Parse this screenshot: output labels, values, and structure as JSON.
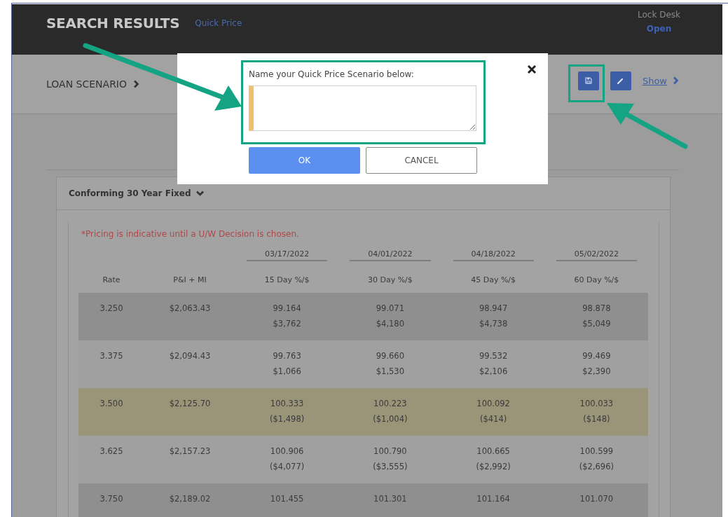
{
  "header": {
    "title": "SEARCH RESULTS",
    "link": "Quick Price",
    "lock_desk": {
      "label": "Lock Desk",
      "status": "Open"
    }
  },
  "loan_scenario": {
    "label": "LOAN SCENARIO",
    "show_link": "Show"
  },
  "product": {
    "title": "Conforming 30 Year Fixed",
    "expanded": true
  },
  "note": "*Pricing is indicative until a U/W Decision is chosen.",
  "table": {
    "dates": [
      "03/17/2022",
      "04/01/2022",
      "04/18/2022",
      "05/02/2022"
    ],
    "columns": [
      "Rate",
      "P&I + MI",
      "15 Day %/$",
      "30 Day %/$",
      "45 Day %/$",
      "60 Day %/$"
    ],
    "rows": [
      {
        "rate": "3.250",
        "payment": "$2,063.43",
        "prices": [
          [
            "99.164",
            "$3,762"
          ],
          [
            "99.071",
            "$4,180"
          ],
          [
            "98.947",
            "$4,738"
          ],
          [
            "98.878",
            "$5,049"
          ]
        ],
        "selected": false
      },
      {
        "rate": "3.375",
        "payment": "$2,094.43",
        "prices": [
          [
            "99.763",
            "$1,066"
          ],
          [
            "99.660",
            "$1,530"
          ],
          [
            "99.532",
            "$2,106"
          ],
          [
            "99.469",
            "$2,390"
          ]
        ],
        "selected": false
      },
      {
        "rate": "3.500",
        "payment": "$2,125.70",
        "prices": [
          [
            "100.333",
            "($1,498)"
          ],
          [
            "100.223",
            "($1,004)"
          ],
          [
            "100.092",
            "($414)"
          ],
          [
            "100.033",
            "($148)"
          ]
        ],
        "selected": true
      },
      {
        "rate": "3.625",
        "payment": "$2,157.23",
        "prices": [
          [
            "100.906",
            "($4,077)"
          ],
          [
            "100.790",
            "($3,555)"
          ],
          [
            "100.665",
            "($2,992)"
          ],
          [
            "100.599",
            "($2,696)"
          ]
        ],
        "selected": false
      },
      {
        "rate": "3.750",
        "payment": "$2,189.02",
        "prices": [
          [
            "101.455"
          ],
          [
            "101.301"
          ],
          [
            "101.164"
          ],
          [
            "101.070"
          ]
        ],
        "selected": false
      }
    ]
  },
  "dialog": {
    "label": "Name your Quick Price Scenario below:",
    "field": {
      "required": true
    },
    "buttons": [
      {
        "label": "OK",
        "kind": "primary"
      },
      {
        "label": "CANCEL",
        "kind": "secondary"
      }
    ]
  }
}
